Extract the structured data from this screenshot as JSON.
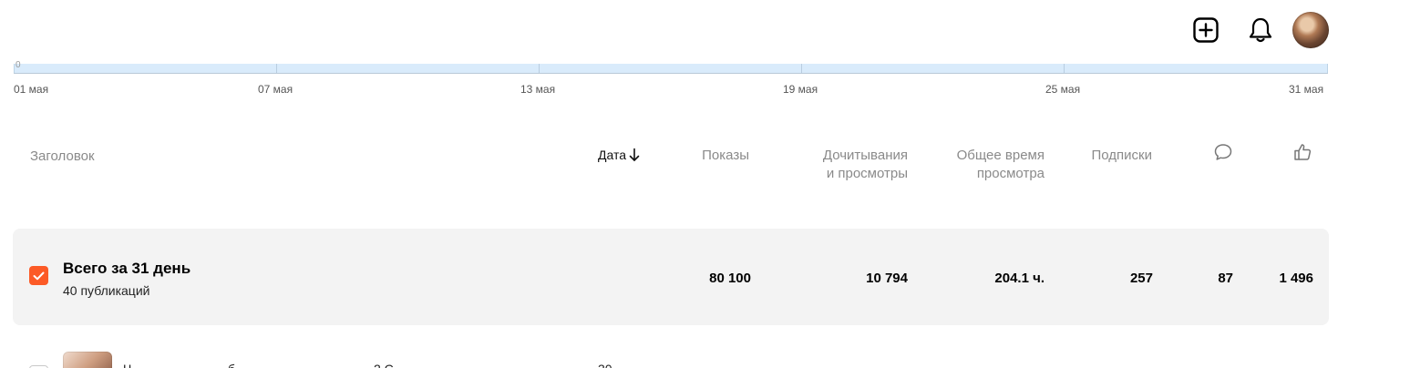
{
  "toolbar": {
    "add_icon": "plus-square-icon",
    "notifications_icon": "bell-icon",
    "avatar": "user-avatar"
  },
  "chart": {
    "y_zero_label": "0",
    "date_ticks": [
      "01 мая",
      "07 мая",
      "13 мая",
      "19 мая",
      "25 мая",
      "31 мая"
    ]
  },
  "table": {
    "headers": {
      "title": "Заголовок",
      "date": "Дата",
      "impressions": "Показы",
      "reads_line1": "Дочитывания",
      "reads_line2": "и просмотры",
      "watch_time_line1": "Общее время",
      "watch_time_line2": "просмотра",
      "subscriptions": "Подписки",
      "comments_icon": "comment-icon",
      "likes_icon": "thumbs-up-icon"
    },
    "sort_icon": "arrow-down-icon",
    "summary": {
      "title": "Всего за 31 день",
      "subtitle": "40 публикаций",
      "impressions": "80 100",
      "reads": "10 794",
      "watch_time": "204.1 ч.",
      "subscriptions": "257",
      "comments": "87",
      "likes": "1 496"
    },
    "next_row": {
      "title_partial": "Ч",
      "title_partial_2": "б",
      "title_partial_3": "2 С",
      "date_partial": "30"
    }
  },
  "colors": {
    "accent": "#fc5a26",
    "chart_fill": "#d9ebfb",
    "row_bg": "#f3f3f3"
  }
}
